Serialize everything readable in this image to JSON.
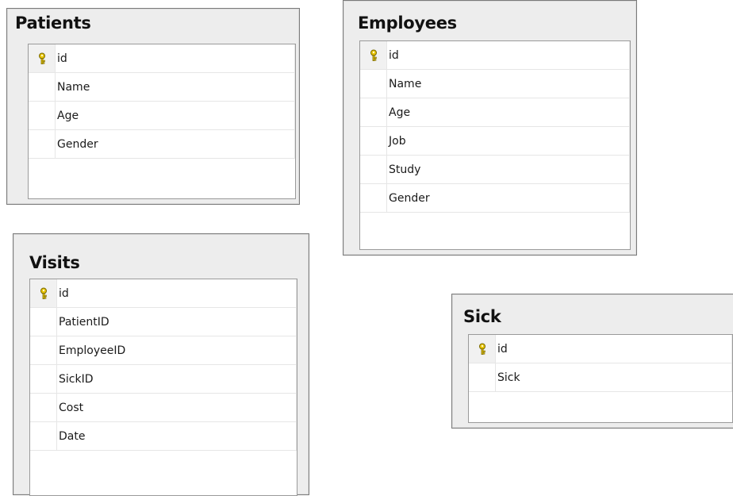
{
  "tables": [
    {
      "title": "Patients",
      "columns": [
        {
          "name": "id",
          "primary_key": true
        },
        {
          "name": "Name",
          "primary_key": false
        },
        {
          "name": "Age",
          "primary_key": false
        },
        {
          "name": "Gender",
          "primary_key": false
        }
      ]
    },
    {
      "title": "Employees",
      "columns": [
        {
          "name": "id",
          "primary_key": true
        },
        {
          "name": "Name",
          "primary_key": false
        },
        {
          "name": "Age",
          "primary_key": false
        },
        {
          "name": "Job",
          "primary_key": false
        },
        {
          "name": "Study",
          "primary_key": false
        },
        {
          "name": "Gender",
          "primary_key": false
        }
      ]
    },
    {
      "title": "Visits",
      "columns": [
        {
          "name": "id",
          "primary_key": true
        },
        {
          "name": "PatientID",
          "primary_key": false
        },
        {
          "name": "EmployeeID",
          "primary_key": false
        },
        {
          "name": "SickID",
          "primary_key": false
        },
        {
          "name": "Cost",
          "primary_key": false
        },
        {
          "name": "Date",
          "primary_key": false
        }
      ]
    },
    {
      "title": "Sick",
      "columns": [
        {
          "name": "id",
          "primary_key": true
        },
        {
          "name": "Sick",
          "primary_key": false
        }
      ]
    }
  ],
  "icons": {
    "primary_key": "key-icon",
    "key_color": "#e8c400"
  }
}
